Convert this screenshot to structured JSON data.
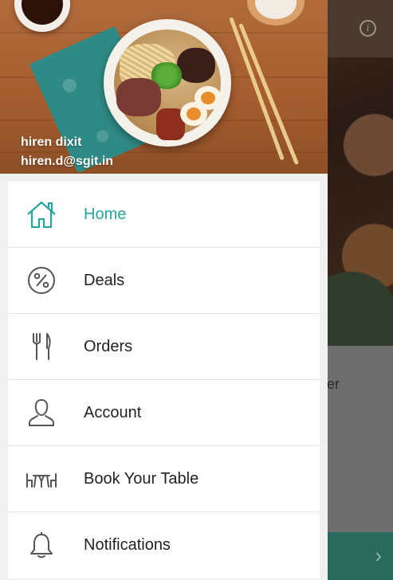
{
  "colors": {
    "accent": "#26a69a",
    "drawer_bg": "#f0f0f0",
    "menu_text": "#222222",
    "icon_gray": "#555555"
  },
  "header": {
    "user_name": "hiren dixit",
    "user_email": "hiren.d@sgit.in"
  },
  "background": {
    "partial_text": "er",
    "info_icon": "i"
  },
  "menu": {
    "items": [
      {
        "label": "Home",
        "icon": "home-icon",
        "active": true
      },
      {
        "label": "Deals",
        "icon": "percent-icon",
        "active": false
      },
      {
        "label": "Orders",
        "icon": "fork-knife-icon",
        "active": false
      },
      {
        "label": "Account",
        "icon": "user-icon",
        "active": false
      },
      {
        "label": "Book Your Table",
        "icon": "table-icon",
        "active": false
      },
      {
        "label": "Notifications",
        "icon": "bell-icon",
        "active": false
      }
    ]
  }
}
